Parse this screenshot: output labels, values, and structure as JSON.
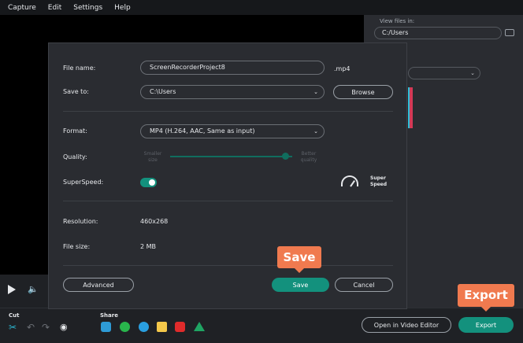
{
  "menu": {
    "items": [
      "Capture",
      "Edit",
      "Settings",
      "Help"
    ]
  },
  "right_panel": {
    "view_files_label": "View files in:",
    "path": "C:/Users"
  },
  "toolbar": {
    "cut_label": "Cut",
    "share_label": "Share"
  },
  "footer": {
    "open_editor_label": "Open in Video Editor",
    "export_label": "Export"
  },
  "callouts": {
    "export": "Export",
    "save": "Save"
  },
  "dialog": {
    "file_name_label": "File name:",
    "file_name_value": "ScreenRecorderProject8",
    "extension": ".mp4",
    "save_to_label": "Save to:",
    "save_to_value": "C:\\Users",
    "browse_label": "Browse",
    "format_label": "Format:",
    "format_value": "MP4 (H.264, AAC, Same as input)",
    "quality_label": "Quality:",
    "quality_low_line1": "Smaller",
    "quality_low_line2": "size",
    "quality_high_line1": "Better",
    "quality_high_line2": "quality",
    "quality_level": 0.95,
    "superspeed_label": "SuperSpeed:",
    "superspeed_on": true,
    "superspeed_badge_line1": "Super",
    "superspeed_badge_line2": "Speed",
    "resolution_label": "Resolution:",
    "resolution_value": "460x268",
    "file_size_label": "File size:",
    "file_size_value": "2 MB",
    "advanced_label": "Advanced",
    "save_label": "Save",
    "cancel_label": "Cancel"
  },
  "colors": {
    "accent": "#13917d",
    "callout": "#f07a4f",
    "dialog_bg": "#2a2c31"
  },
  "icons": [
    "play-icon",
    "volume-icon",
    "scissors-icon",
    "undo-icon",
    "redo-icon",
    "camera-icon",
    "cloud-icon",
    "whatsapp-icon",
    "telegram-icon",
    "file-icon",
    "youtube-icon",
    "drive-icon",
    "folder-icon",
    "superspeed-gauge-icon",
    "chevron-down-icon"
  ]
}
